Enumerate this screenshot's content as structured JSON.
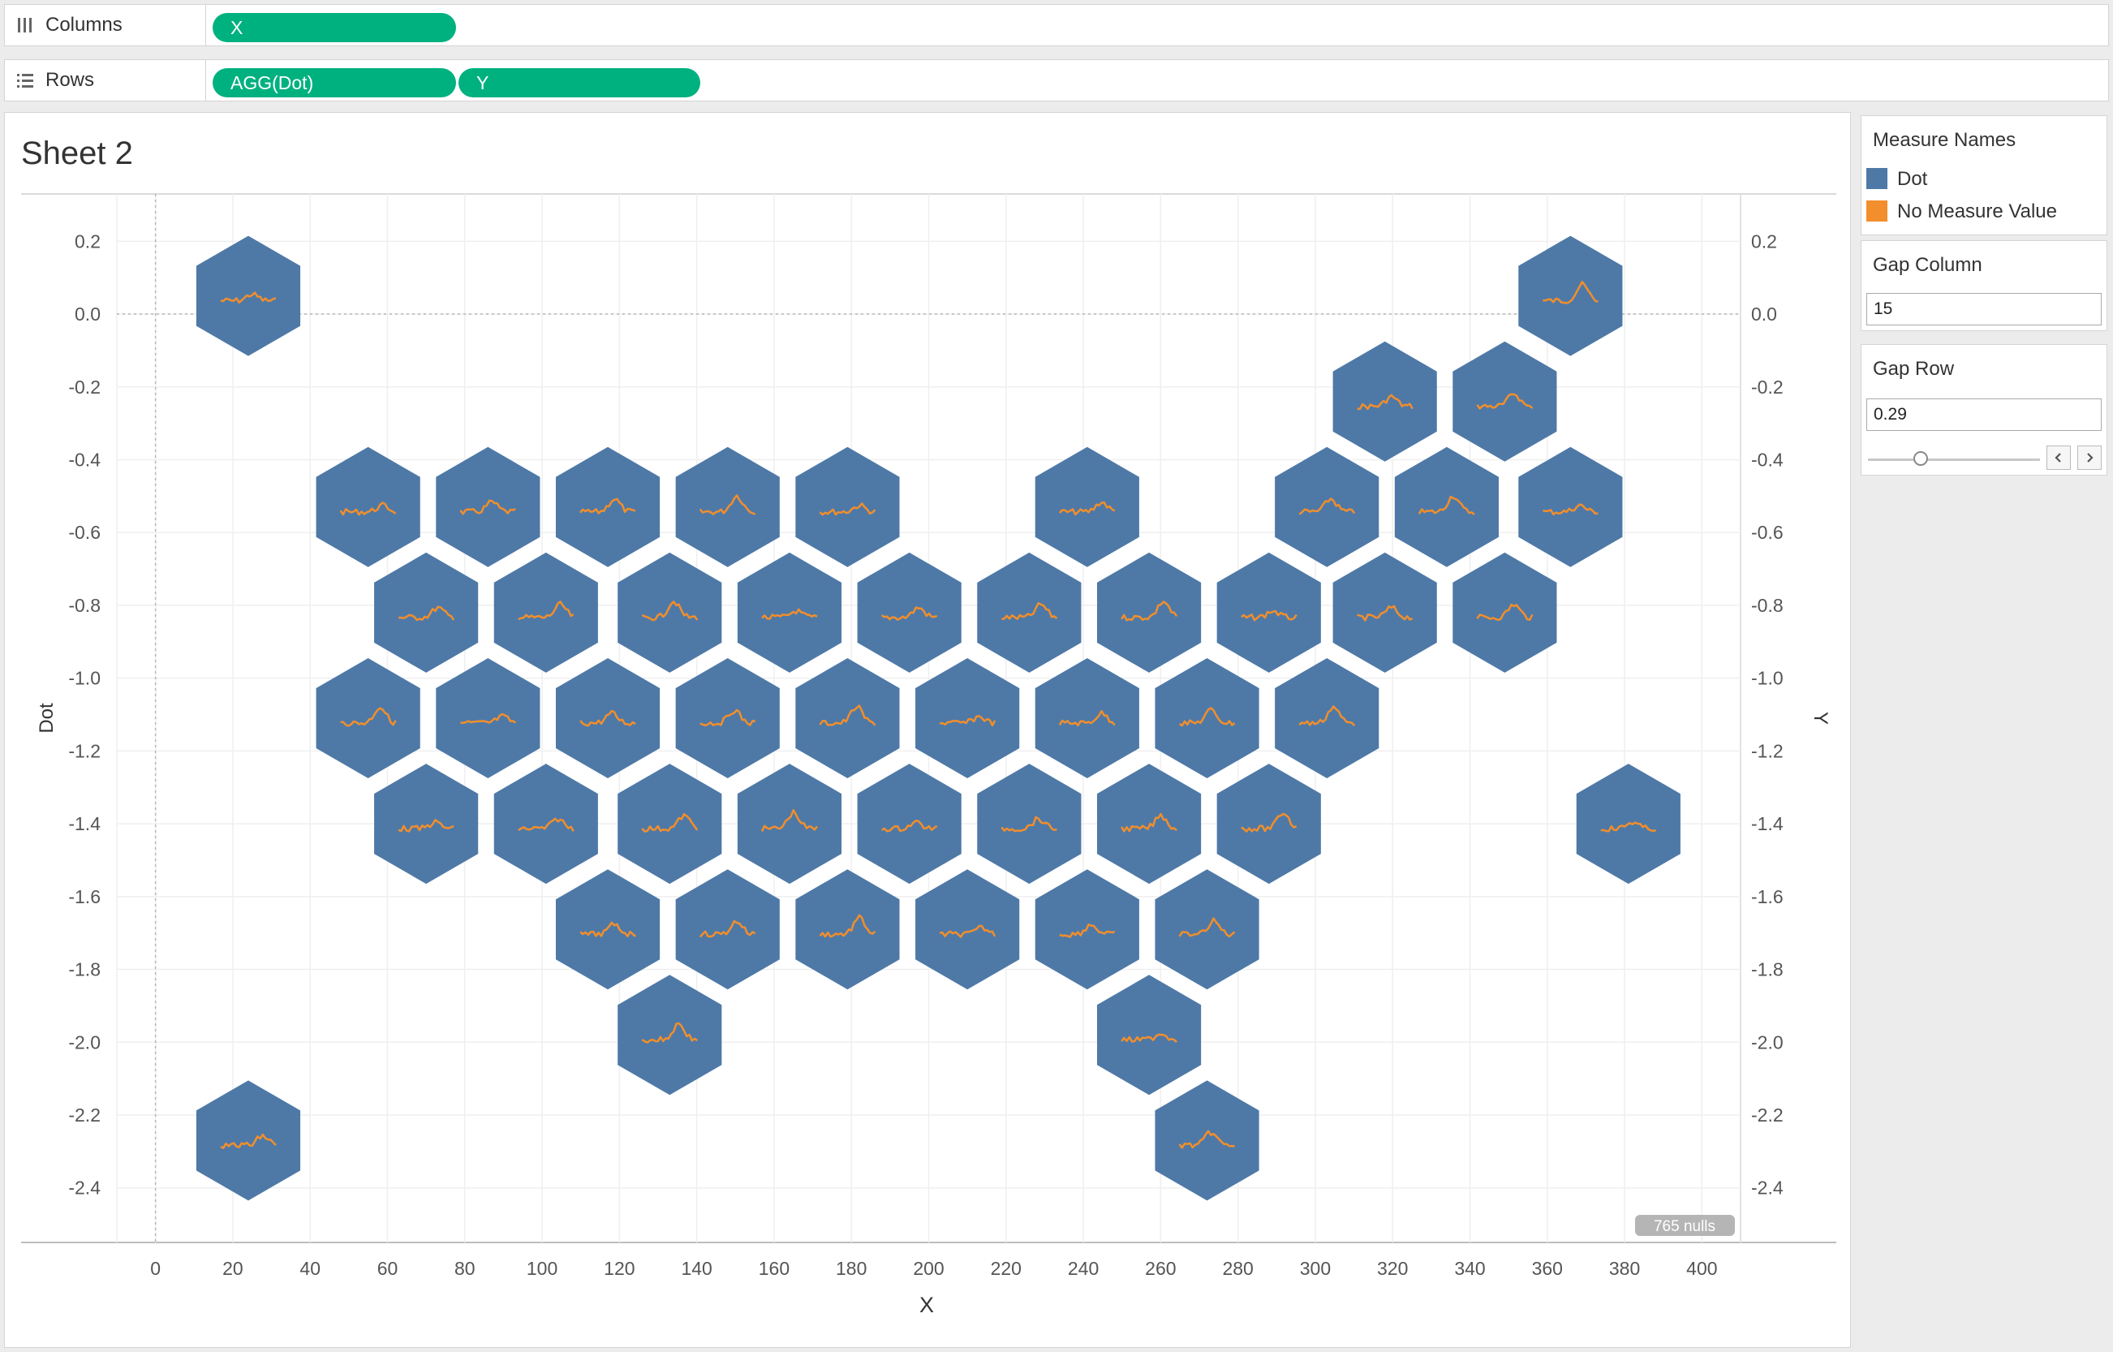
{
  "shelves": {
    "columns": {
      "label": "Columns",
      "pills": [
        "X"
      ]
    },
    "rows": {
      "label": "Rows",
      "pills": [
        "AGG(Dot)",
        "Y"
      ]
    }
  },
  "sheet": {
    "title": "Sheet 2"
  },
  "legend": {
    "title": "Measure Names",
    "items": [
      {
        "label": "Dot",
        "color": "#4e79a7"
      },
      {
        "label": "No Measure Value",
        "color": "#f28e2b"
      }
    ]
  },
  "parameters": {
    "gap_column": {
      "title": "Gap Column",
      "value": "15"
    },
    "gap_row": {
      "title": "Gap Row",
      "value": "0.29"
    }
  },
  "null_badge": "765 nulls",
  "chart_data": {
    "type": "scatter",
    "mark": "hexagon",
    "xlabel": "X",
    "ylabel_left": "Dot",
    "ylabel_right": "Y",
    "xlim": [
      -10,
      410
    ],
    "ylim": [
      -2.55,
      0.33
    ],
    "x_ticks": [
      0,
      20,
      40,
      60,
      80,
      100,
      120,
      140,
      160,
      180,
      200,
      220,
      240,
      260,
      280,
      300,
      320,
      340,
      360,
      380,
      400
    ],
    "y_ticks": [
      0.2,
      0.0,
      -0.2,
      -0.4,
      -0.6,
      -0.8,
      -1.0,
      -1.2,
      -1.4,
      -1.6,
      -1.8,
      -2.0,
      -2.2,
      -2.4
    ],
    "y_tick_labels": [
      "0.2",
      "0.0",
      "-0.2",
      "-0.4",
      "-0.6",
      "-0.8",
      "-1.0",
      "-1.2",
      "-1.4",
      "-1.6",
      "-1.8",
      "-2.0",
      "-2.2",
      "-2.4"
    ],
    "colors": {
      "hex": "#4e79a7",
      "sparkline": "#f28e2b"
    },
    "series": [
      {
        "name": "Dot",
        "points": [
          [
            24,
            0.05
          ],
          [
            318,
            -0.24
          ],
          [
            349,
            -0.24
          ],
          [
            366,
            0.05
          ],
          [
            55,
            -0.53
          ],
          [
            86,
            -0.53
          ],
          [
            117,
            -0.53
          ],
          [
            148,
            -0.53
          ],
          [
            179,
            -0.53
          ],
          [
            241,
            -0.53
          ],
          [
            303,
            -0.53
          ],
          [
            334,
            -0.53
          ],
          [
            366,
            -0.53
          ],
          [
            70,
            -0.82
          ],
          [
            101,
            -0.82
          ],
          [
            133,
            -0.82
          ],
          [
            164,
            -0.82
          ],
          [
            195,
            -0.82
          ],
          [
            226,
            -0.82
          ],
          [
            257,
            -0.82
          ],
          [
            288,
            -0.82
          ],
          [
            318,
            -0.82
          ],
          [
            349,
            -0.82
          ],
          [
            55,
            -1.11
          ],
          [
            86,
            -1.11
          ],
          [
            117,
            -1.11
          ],
          [
            148,
            -1.11
          ],
          [
            179,
            -1.11
          ],
          [
            210,
            -1.11
          ],
          [
            241,
            -1.11
          ],
          [
            272,
            -1.11
          ],
          [
            303,
            -1.11
          ],
          [
            70,
            -1.4
          ],
          [
            101,
            -1.4
          ],
          [
            133,
            -1.4
          ],
          [
            164,
            -1.4
          ],
          [
            195,
            -1.4
          ],
          [
            226,
            -1.4
          ],
          [
            257,
            -1.4
          ],
          [
            288,
            -1.4
          ],
          [
            381,
            -1.4
          ],
          [
            117,
            -1.69
          ],
          [
            148,
            -1.69
          ],
          [
            179,
            -1.69
          ],
          [
            210,
            -1.69
          ],
          [
            241,
            -1.69
          ],
          [
            272,
            -1.69
          ],
          [
            133,
            -1.98
          ],
          [
            257,
            -1.98
          ],
          [
            24,
            -2.27
          ],
          [
            272,
            -2.27
          ]
        ]
      }
    ]
  }
}
